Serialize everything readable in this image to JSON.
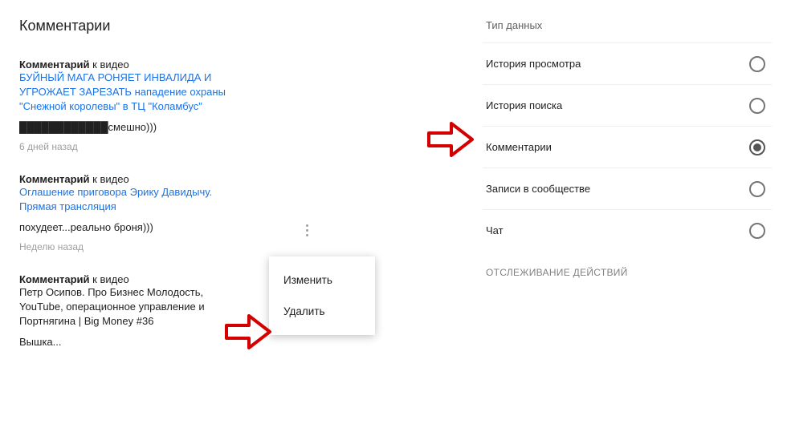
{
  "left": {
    "title": "Комментарии",
    "item_prefix": "Комментарий",
    "item_connector": " к видео",
    "items": [
      {
        "video_title": "БУЙНЫЙ МАГА РОНЯЕТ ИНВАЛИДА И УГРОЖАЕТ ЗАРЕЗАТЬ нападение охраны \"Снежной королевы\" в ТЦ \"Коламбус\"",
        "link_blue": true,
        "comment": "████████████смешно)))",
        "timestamp": "6 дней назад"
      },
      {
        "video_title": "Оглашение приговора Эрику Давидычу. Прямая трансляция",
        "link_blue": true,
        "comment": "похудеет...реально броня)))",
        "timestamp": "Неделю назад"
      },
      {
        "video_title": "Петр Осипов. Про Бизнес Молодость, YouTube, операционное управление и Портнягина | Big Money #36",
        "link_blue": false,
        "comment": "Вышка...",
        "timestamp": ""
      }
    ],
    "popup": {
      "edit": "Изменить",
      "delete": "Удалить"
    }
  },
  "right": {
    "header": "Тип данных",
    "options": [
      {
        "label": "История просмотра",
        "selected": false
      },
      {
        "label": "История поиска",
        "selected": false
      },
      {
        "label": "Комментарии",
        "selected": true
      },
      {
        "label": "Записи в сообществе",
        "selected": false
      },
      {
        "label": "Чат",
        "selected": false
      }
    ],
    "subheader": "ОТСЛЕЖИВАНИЕ ДЕЙСТВИЙ"
  }
}
